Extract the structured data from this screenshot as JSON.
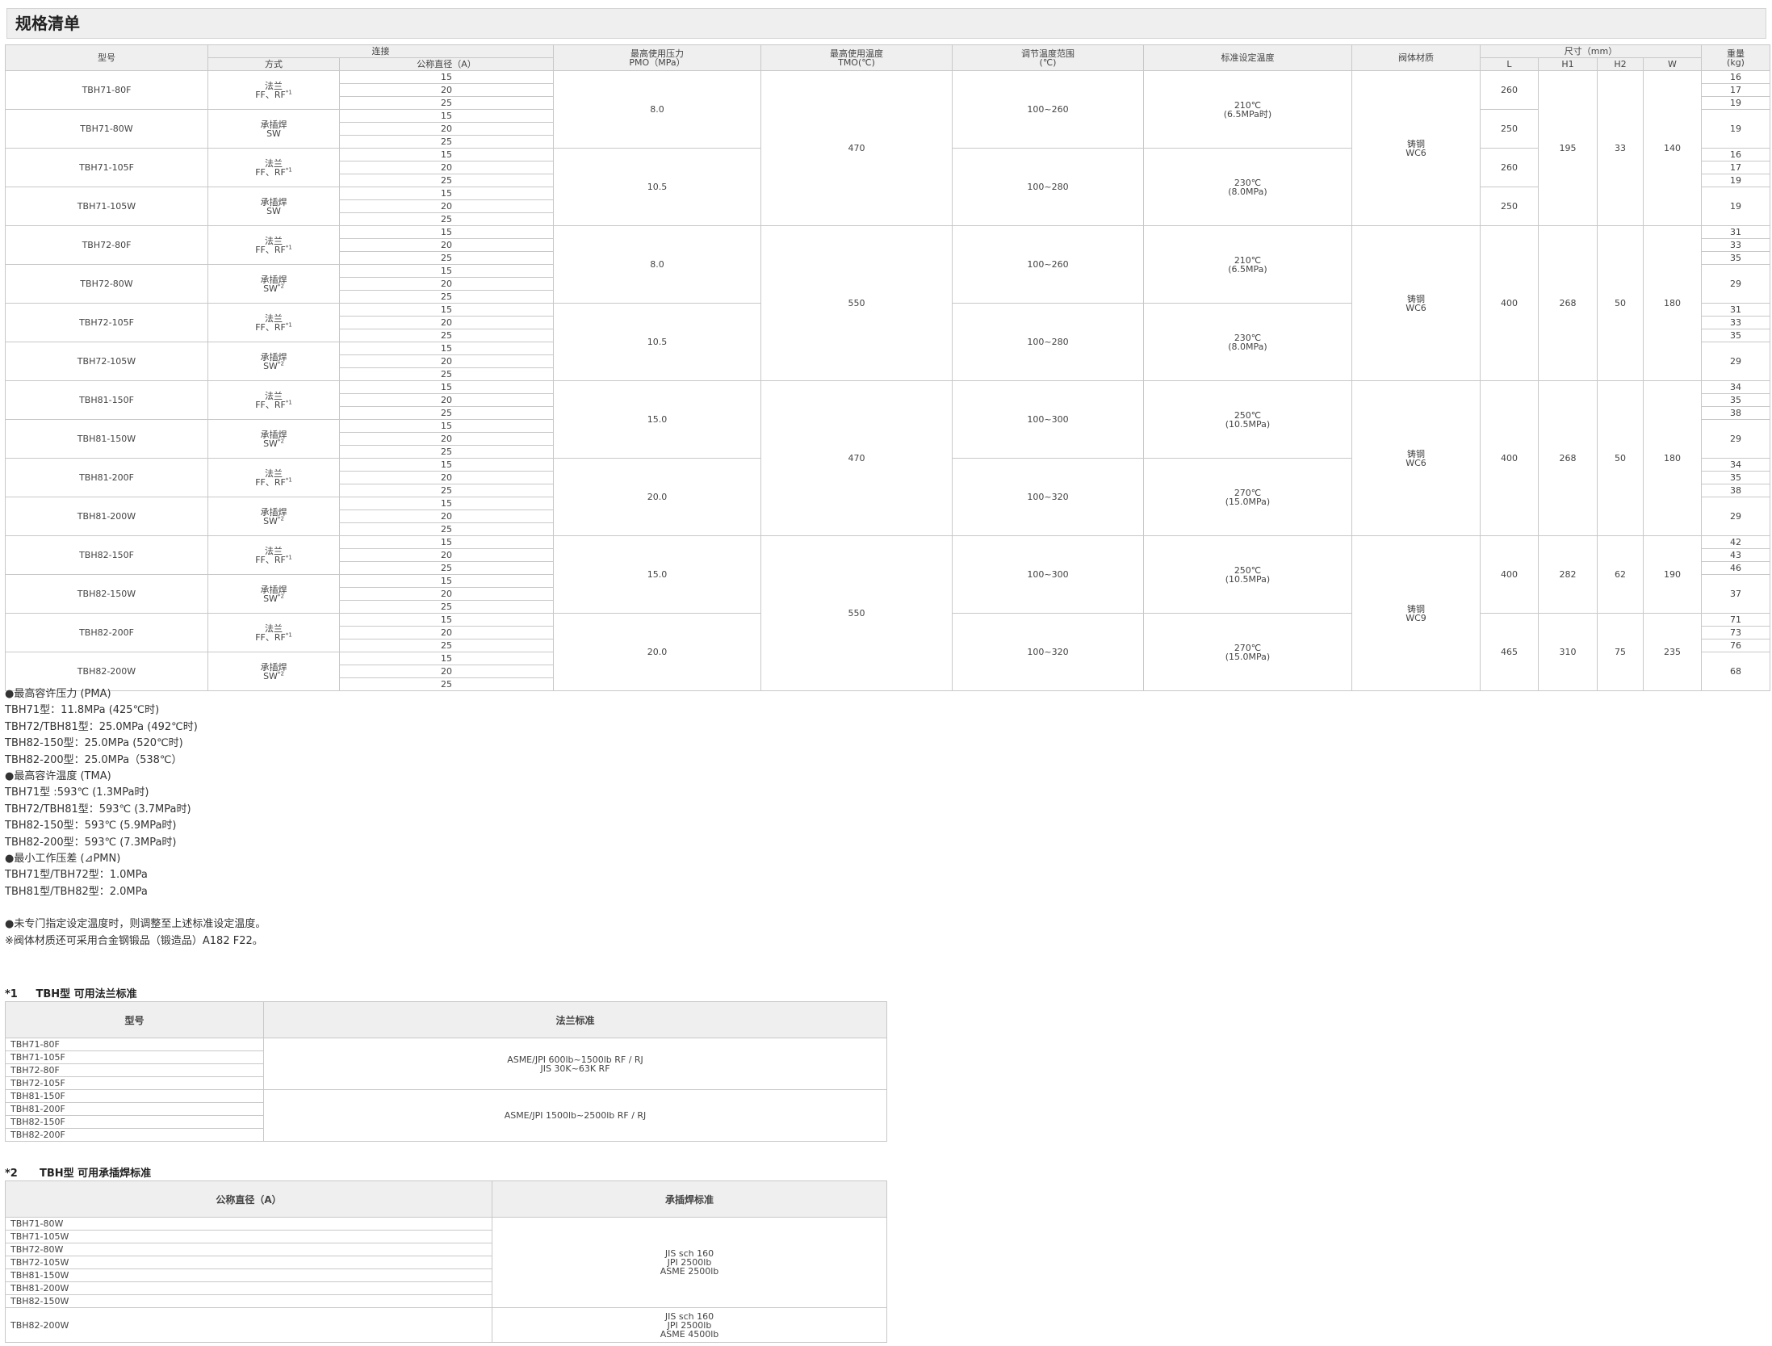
{
  "page": {
    "title": "规格清单"
  },
  "main_table": {
    "h": {
      "model": "型号",
      "conn": "连接",
      "method": "方式",
      "dn": "公称直径（A）",
      "pmo1": "最高使用压力",
      "pmo2": "PMO（MPa）",
      "tmo1": "最高使用温度",
      "tmo2": "TMO(℃)",
      "range1": "调节温度范围",
      "range2": "(℃)",
      "std": "标准设定温度",
      "mat": "阀体材质",
      "dim": "尺寸（mm）",
      "L": "L",
      "H1": "H1",
      "H2": "H2",
      "W": "W",
      "wt1": "重量",
      "wt2": "(kg)"
    },
    "sizes": [
      "15",
      "20",
      "25"
    ],
    "flange": "法兰",
    "flange_code": "FF、RF",
    "sw": "承插焊",
    "sw_code": "SW",
    "sup1": "*1",
    "sup2": "*2",
    "models": [
      "TBH71-80F",
      "TBH71-80W",
      "TBH71-105F",
      "TBH71-105W",
      "TBH72-80F",
      "TBH72-80W",
      "TBH72-105F",
      "TBH72-105W",
      "TBH81-150F",
      "TBH81-150W",
      "TBH81-200F",
      "TBH81-200W",
      "TBH82-150F",
      "TBH82-150W",
      "TBH82-200F",
      "TBH82-200W"
    ],
    "pmo": [
      "8.0",
      "10.5",
      "8.0",
      "10.5",
      "15.0",
      "20.0",
      "15.0",
      "20.0"
    ],
    "tmo": [
      "470",
      "550",
      "470",
      "550"
    ],
    "range": [
      "100~260",
      "100~280",
      "100~260",
      "100~280",
      "100~300",
      "100~320",
      "100~300",
      "100~320"
    ],
    "std_temp": [
      "210℃",
      "230℃",
      "210℃",
      "230℃",
      "250℃",
      "270℃",
      "250℃",
      "270℃"
    ],
    "std_press": [
      "(6.5MPa时)",
      "(8.0MPa)",
      "(6.5MPa)",
      "(8.0MPa)",
      "(10.5MPa)",
      "(15.0MPa)",
      "(10.5MPa)",
      "(15.0MPa)"
    ],
    "mat1": [
      "铸钢",
      "铸钢",
      "铸钢",
      "铸钢"
    ],
    "mat2": [
      "WC6",
      "WC6",
      "WC6",
      "WC9"
    ],
    "g1": {
      "L": [
        "260",
        "250",
        "260",
        "250"
      ],
      "H1": "195",
      "H2": "33",
      "W": "140"
    },
    "g2": {
      "L": "400",
      "H1": "268",
      "H2": "50",
      "W": "180"
    },
    "g3": {
      "L": "400",
      "H1": "268",
      "H2": "50",
      "W": "180"
    },
    "g4": {
      "L": [
        "400",
        "465"
      ],
      "H1": [
        "282",
        "310"
      ],
      "H2": [
        "62",
        "75"
      ],
      "W": [
        "190",
        "235"
      ]
    },
    "weights": {
      "g1": [
        [
          "16",
          "17",
          "19"
        ],
        [
          "19"
        ],
        [
          "16",
          "17",
          "19"
        ],
        [
          "19"
        ]
      ],
      "g2": [
        [
          "31",
          "33",
          "35"
        ],
        [
          "29"
        ],
        [
          "31",
          "33",
          "35"
        ],
        [
          "29"
        ]
      ],
      "g3": [
        [
          "34",
          "35",
          "38"
        ],
        [
          "29"
        ],
        [
          "34",
          "35",
          "38"
        ],
        [
          "29"
        ]
      ],
      "g4": [
        [
          "42",
          "43",
          "46"
        ],
        [
          "37"
        ],
        [
          "71",
          "73",
          "76"
        ],
        [
          "68"
        ]
      ]
    }
  },
  "notes": [
    "●最高容许压力 (PMA)",
    "TBH71型：11.8MPa (425℃时)",
    "TBH72/TBH81型：25.0MPa (492℃时)",
    "TBH82-150型：25.0MPa (520℃时)",
    "TBH82-200型：25.0MPa（538℃）",
    "●最高容许温度 (TMA)",
    "TBH71型 :593℃ (1.3MPa时)",
    "TBH72/TBH81型：593℃ (3.7MPa时)",
    "TBH82-150型：593℃ (5.9MPa时)",
    "TBH82-200型：593℃ (7.3MPa时)",
    "●最小工作压差 (⊿PMN)",
    "TBH71型/TBH72型：1.0MPa",
    "TBH81型/TBH82型：2.0MPa",
    "",
    "●未专门指定设定温度时，则调整至上述标准设定温度。",
    "※阀体材质还可采用合金钢锻品（锻造品）A182 F22。"
  ],
  "flange_table": {
    "title_prefix": "*1",
    "title": "TBH型 可用法兰标准",
    "h_model": "型号",
    "h_std": "法兰标准",
    "group1_models": [
      "TBH71-80F",
      "TBH71-105F",
      "TBH72-80F",
      "TBH72-105F"
    ],
    "group1_std": [
      "ASME/JPI 600lb~1500lb RF / RJ",
      "JIS 30K~63K RF"
    ],
    "group2_models": [
      "TBH81-150F",
      "TBH81-200F",
      "TBH82-150F",
      "TBH82-200F"
    ],
    "group2_std": [
      "ASME/JPI 1500lb~2500lb RF / RJ"
    ]
  },
  "sw_table": {
    "title_prefix": "*2",
    "title": "TBH型 可用承插焊标准",
    "h_model": "公称直径（A）",
    "h_std": "承插焊标准",
    "group1_models": [
      "TBH71-80W",
      "TBH71-105W",
      "TBH72-80W",
      "TBH72-105W",
      "TBH81-150W",
      "TBH81-200W",
      "TBH82-150W"
    ],
    "group1_std": [
      "JIS sch 160",
      "JPI 2500lb",
      "ASME 2500lb"
    ],
    "group2_models": [
      "TBH82-200W"
    ],
    "group2_std": [
      "JIS sch 160",
      "JPI 2500lb",
      "ASME 4500lb"
    ]
  }
}
